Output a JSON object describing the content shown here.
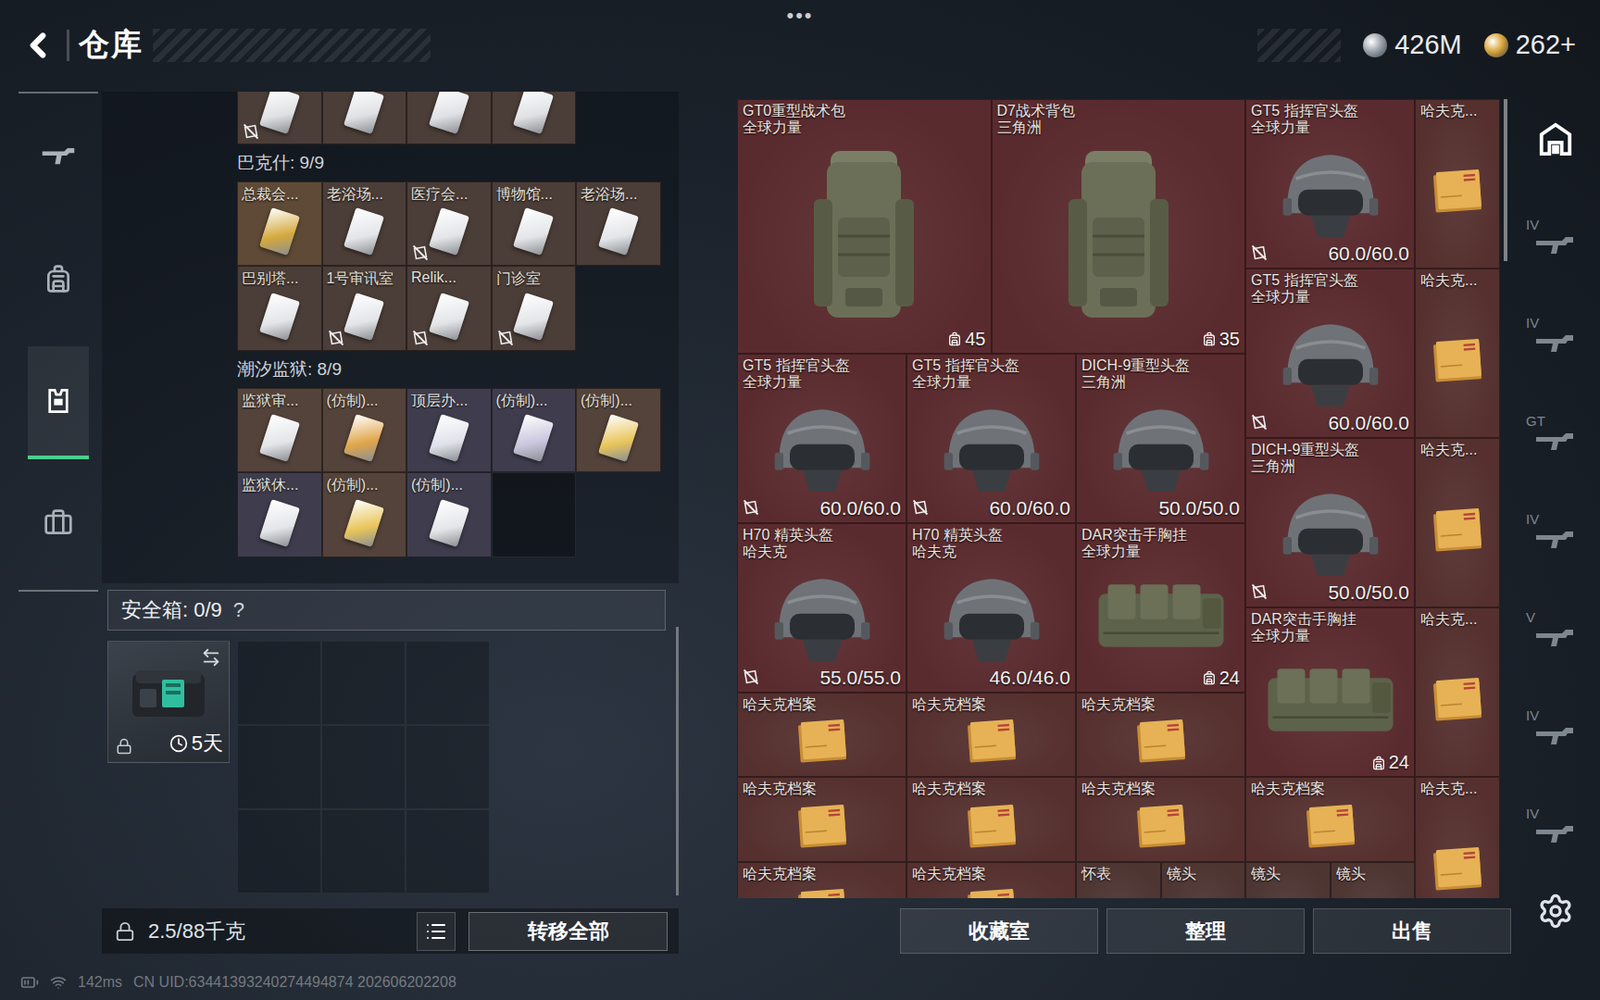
{
  "topbar": {
    "title": "仓库",
    "menu": "•••",
    "currencies": [
      {
        "amount": "426M",
        "color": "#9aa3ad"
      },
      {
        "amount": "262+",
        "color": "#d9a53a"
      }
    ]
  },
  "nav": [
    {
      "kind": "weapon",
      "selected": false
    },
    {
      "kind": "backpack",
      "selected": false
    },
    {
      "kind": "rig",
      "selected": true
    },
    {
      "kind": "case",
      "selected": false
    }
  ],
  "storage": {
    "sections": [
      {
        "slots": [
          {
            "filled": true,
            "notrade": true,
            "card": "#dfe1e4",
            "color": "#4b3d37"
          },
          {
            "filled": true,
            "notrade": false,
            "card": "#dfe1e4",
            "color": "#4b3d37"
          },
          {
            "filled": true,
            "notrade": false,
            "card": "#dfe1e4",
            "color": "#4b3d37"
          },
          {
            "filled": true,
            "notrade": false,
            "card": "#dfe1e4",
            "color": "#4b3d37"
          }
        ]
      },
      {
        "title": "巴克什: 9/9",
        "slots": [
          {
            "filled": true,
            "label": "总裁会...",
            "notrade": false,
            "card": "#d4a93c",
            "color": "#5e4a36"
          },
          {
            "filled": true,
            "label": "老浴场...",
            "notrade": false,
            "card": "#e3e5e8",
            "color": "#4b3d37"
          },
          {
            "filled": true,
            "label": "医疗会...",
            "notrade": true,
            "card": "#e3e5e8",
            "color": "#4b3d37"
          },
          {
            "filled": true,
            "label": "博物馆...",
            "notrade": false,
            "card": "#e3e5e8",
            "color": "#4b3d37"
          },
          {
            "filled": true,
            "label": "老浴场...",
            "notrade": false,
            "card": "#e3e5e8",
            "color": "#4b3d37"
          },
          {
            "filled": true,
            "label": "巴别塔...",
            "notrade": false,
            "card": "#e3e5e8",
            "color": "#4b3d37"
          },
          {
            "filled": true,
            "label": "1号审讯室",
            "notrade": true,
            "card": "#e3e5e8",
            "color": "#4b3d37"
          },
          {
            "filled": true,
            "label": "Relik...",
            "notrade": true,
            "card": "#e3e5e8",
            "color": "#4b3d37"
          },
          {
            "filled": true,
            "label": "门诊室",
            "notrade": true,
            "card": "#e3e5e8",
            "color": "#4b3d37"
          }
        ]
      },
      {
        "title": "潮汐监狱: 8/9",
        "slots": [
          {
            "filled": true,
            "label": "监狱审...",
            "notrade": false,
            "card": "#e3e5e8",
            "color": "#54433a"
          },
          {
            "filled": true,
            "label": "(仿制)...",
            "notrade": false,
            "card": "#e0a54a",
            "color": "#54433a"
          },
          {
            "filled": true,
            "label": "顶层办...",
            "notrade": false,
            "card": "#dfe2ea",
            "color": "#3f3d4d"
          },
          {
            "filled": true,
            "label": "(仿制)...",
            "notrade": false,
            "card": "#c9c6de",
            "color": "#3f3d4d"
          },
          {
            "filled": true,
            "label": "(仿制)...",
            "notrade": false,
            "card": "#e8c55a",
            "color": "#54433a"
          },
          {
            "filled": true,
            "label": "监狱休...",
            "notrade": false,
            "card": "#e3e5e8",
            "color": "#3f3d4d"
          },
          {
            "filled": true,
            "label": "(仿制)...",
            "notrade": false,
            "card": "#e8c55a",
            "color": "#54433a"
          },
          {
            "filled": true,
            "label": "(仿制)...",
            "notrade": false,
            "card": "#e3e5e8",
            "color": "#3f3d4d"
          },
          {
            "filled": false
          }
        ]
      }
    ]
  },
  "secure": {
    "label": "安全箱: 0/9",
    "help": "?",
    "timer": "5天",
    "locked": true,
    "slots": [
      {
        "filled": false
      },
      {
        "filled": false
      },
      {
        "filled": false
      },
      {
        "filled": false
      },
      {
        "filled": false
      },
      {
        "filled": false
      },
      {
        "filled": false
      },
      {
        "filled": false
      },
      {
        "filled": false
      }
    ]
  },
  "footer": {
    "weight": "2.5/88千克",
    "transfer": "转移全部"
  },
  "inventory": {
    "items": [
      {
        "name": "GT0重型战术包",
        "origin": "全球力量",
        "kind": "bag",
        "capacity": "45",
        "notrade": false,
        "color": "#5a2b2e"
      },
      {
        "name": "D7战术背包",
        "origin": "三角洲",
        "kind": "bag",
        "capacity": "35",
        "notrade": false,
        "color": "#5a2b2e"
      },
      {
        "name": "GT5 指挥官头盔",
        "origin": "全球力量",
        "kind": "helmet",
        "durability": "60.0/60.0",
        "notrade": true,
        "color": "#5a2b2e"
      },
      {
        "name": "哈夫克...",
        "kind": "archive",
        "notrade": false,
        "color": "#55302f"
      },
      {
        "name": "GT5 指挥官头盔",
        "origin": "全球力量",
        "kind": "helmet",
        "durability": "60.0/60.0",
        "notrade": true,
        "color": "#5a2b2e"
      },
      {
        "name": "哈夫克...",
        "kind": "archive",
        "notrade": false,
        "color": "#55302f"
      },
      {
        "name": "GT5 指挥官头盔",
        "origin": "全球力量",
        "kind": "helmet",
        "durability": "60.0/60.0",
        "notrade": true,
        "color": "#5a2b2e"
      },
      {
        "name": "GT5 指挥官头盔",
        "origin": "全球力量",
        "kind": "helmet",
        "durability": "60.0/60.0",
        "notrade": true,
        "color": "#5a2b2e"
      },
      {
        "name": "DICH-9重型头盔",
        "origin": "三角洲",
        "kind": "helmet",
        "durability": "50.0/50.0",
        "notrade": false,
        "color": "#5a2b2e"
      },
      {
        "name": "DICH-9重型头盔",
        "origin": "三角洲",
        "kind": "helmet",
        "durability": "50.0/50.0",
        "notrade": true,
        "color": "#5a2b2e"
      },
      {
        "name": "哈夫克...",
        "kind": "archive",
        "notrade": false,
        "color": "#55302f"
      },
      {
        "name": "H70 精英头盔",
        "origin": "哈夫克",
        "kind": "helmet",
        "durability": "55.0/55.0",
        "notrade": true,
        "color": "#5a2b2e"
      },
      {
        "name": "H70 精英头盔",
        "origin": "哈夫克",
        "kind": "helmet",
        "durability": "46.0/46.0",
        "notrade": false,
        "color": "#5a2b2e"
      },
      {
        "name": "DAR突击手胸挂",
        "origin": "全球力量",
        "kind": "chest",
        "capacity": "24",
        "notrade": false,
        "color": "#5a2b2e"
      },
      {
        "name": "DAR突击手胸挂",
        "origin": "全球力量",
        "kind": "chest",
        "capacity": "24",
        "notrade": false,
        "color": "#5a2b2e"
      },
      {
        "name": "哈夫克...",
        "kind": "archive",
        "notrade": false,
        "color": "#55302f"
      },
      {
        "name": "哈夫克档案",
        "kind": "archive",
        "notrade": false,
        "color": "#55302f"
      },
      {
        "name": "哈夫克档案",
        "kind": "archive",
        "notrade": false,
        "color": "#55302f"
      },
      {
        "name": "哈夫克档案",
        "kind": "archive",
        "notrade": false,
        "color": "#55302f"
      },
      {
        "name": "哈夫克档案",
        "kind": "archive",
        "notrade": false,
        "color": "#55302f"
      },
      {
        "name": "哈夫克档案",
        "kind": "archive",
        "notrade": false,
        "color": "#55302f"
      },
      {
        "name": "哈夫克档案",
        "kind": "archive",
        "notrade": false,
        "color": "#55302f"
      },
      {
        "name": "哈夫克档案",
        "kind": "archive",
        "notrade": false,
        "color": "#55302f"
      },
      {
        "name": "哈夫克...",
        "kind": "archive",
        "notrade": false,
        "color": "#55302f"
      },
      {
        "name": "哈夫克档案",
        "kind": "archive",
        "notrade": false,
        "color": "#55302f"
      },
      {
        "name": "哈夫克档案",
        "kind": "archive",
        "notrade": false,
        "color": "#55302f"
      },
      {
        "name": "怀表",
        "kind": "watch",
        "notrade": false,
        "color": "#4d3532"
      },
      {
        "name": "镜头",
        "kind": "lens",
        "notrade": false,
        "color": "#4d3532"
      },
      {
        "name": "镜头",
        "kind": "lens",
        "notrade": false,
        "color": "#4d3532"
      },
      {
        "name": "镜头",
        "kind": "lens",
        "notrade": false,
        "color": "#4d3532"
      }
    ]
  },
  "actions": [
    "收藏室",
    "整理",
    "出售"
  ],
  "sidetabs": [
    {
      "kind": "home",
      "selected": true
    },
    {
      "label": "IV",
      "kind": "weapon",
      "selected": false
    },
    {
      "label": "IV",
      "kind": "weapon",
      "selected": false
    },
    {
      "label": "GT",
      "kind": "weapon",
      "selected": false
    },
    {
      "label": "IV",
      "kind": "weapon",
      "selected": false
    },
    {
      "label": "V",
      "kind": "weapon",
      "selected": false
    },
    {
      "label": "IV",
      "kind": "weapon",
      "selected": false
    },
    {
      "label": "IV",
      "kind": "weapon",
      "selected": false
    }
  ],
  "status": {
    "ping": "142ms",
    "uid": "CN UID:63441393240274494874 202606202208"
  }
}
